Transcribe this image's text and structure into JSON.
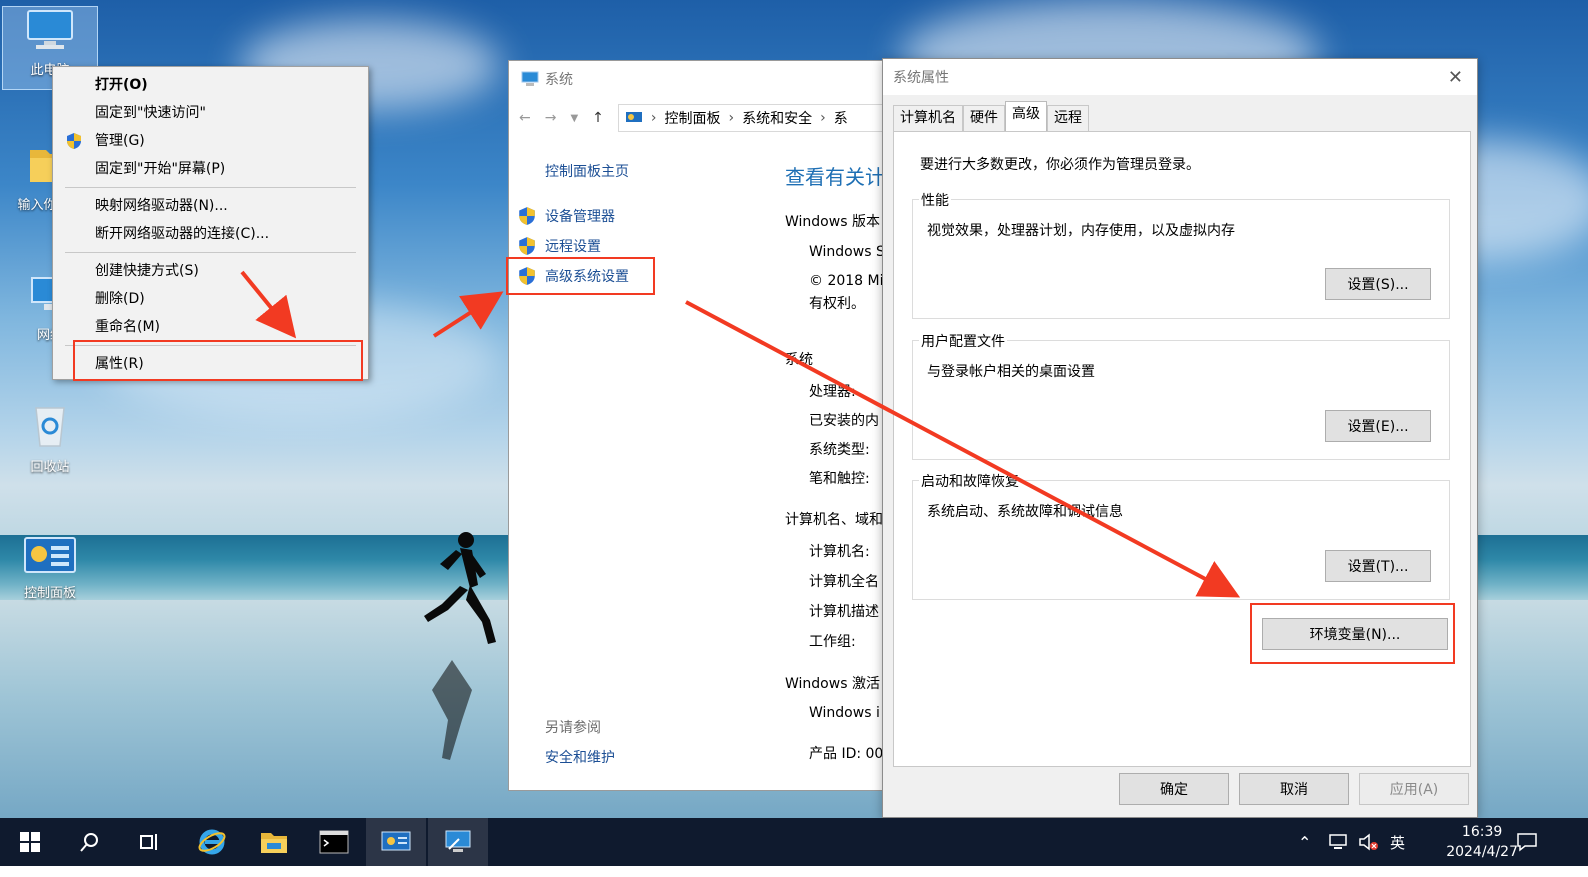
{
  "desktop": {
    "icons": [
      {
        "label": "此电脑",
        "icon": "computer-icon"
      },
      {
        "label": "输入你的名",
        "icon": "folder-icon"
      },
      {
        "label": "网络",
        "icon": "network-icon"
      },
      {
        "label": "回收站",
        "icon": "recycle-bin-icon"
      },
      {
        "label": "控制面板",
        "icon": "control-panel-icon"
      }
    ]
  },
  "context_menu": {
    "items": [
      {
        "label": "打开(O)",
        "bold": true
      },
      {
        "label": "固定到\"快速访问\""
      },
      {
        "label": "管理(G)",
        "icon": "shield-icon"
      },
      {
        "label": "固定到\"开始\"屏幕(P)"
      },
      {
        "label": "映射网络驱动器(N)..."
      },
      {
        "label": "断开网络驱动器的连接(C)..."
      },
      {
        "label": "创建快捷方式(S)"
      },
      {
        "label": "删除(D)"
      },
      {
        "label": "重命名(M)"
      },
      {
        "label": "属性(R)"
      }
    ]
  },
  "system_window": {
    "title": "系统",
    "breadcrumb": [
      "控制面板",
      "系统和安全",
      "系"
    ],
    "nav_home": "控制面板主页",
    "nav_links": [
      "设备管理器",
      "远程设置",
      "高级系统设置"
    ],
    "see_also": "另请参阅",
    "see_also_link": "安全和维护",
    "heading": "查看有关计",
    "rows": [
      "Windows 版本",
      "Windows S",
      "© 2018 Mi",
      "有权利。",
      "系统",
      "处理器:",
      "已安装的内",
      "系统类型:",
      "笔和触控:",
      "计算机名、域和",
      "计算机名:",
      "计算机全名",
      "计算机描述",
      "工作组:",
      "Windows 激活",
      "Windows i",
      "产品 ID: 00"
    ]
  },
  "properties_dialog": {
    "title": "系统属性",
    "tabs": [
      "计算机名",
      "硬件",
      "高级",
      "远程"
    ],
    "active_tab": "高级",
    "note": "要进行大多数更改，你必须作为管理员登录。",
    "groups": [
      {
        "title": "性能",
        "desc": "视觉效果，处理器计划，内存使用，以及虚拟内存",
        "button": "设置(S)..."
      },
      {
        "title": "用户配置文件",
        "desc": "与登录帐户相关的桌面设置",
        "button": "设置(E)..."
      },
      {
        "title": "启动和故障恢复",
        "desc": "系统启动、系统故障和调试信息",
        "button": "设置(T)..."
      }
    ],
    "env_button": "环境变量(N)...",
    "ok": "确定",
    "cancel": "取消",
    "apply": "应用(A)"
  },
  "taskbar": {
    "ime": "英",
    "time": "16:39",
    "date": "2024/4/27"
  },
  "colors": {
    "highlight": "#f23a22",
    "link": "#1c4f95",
    "taskbar": "#0f1a2e"
  }
}
